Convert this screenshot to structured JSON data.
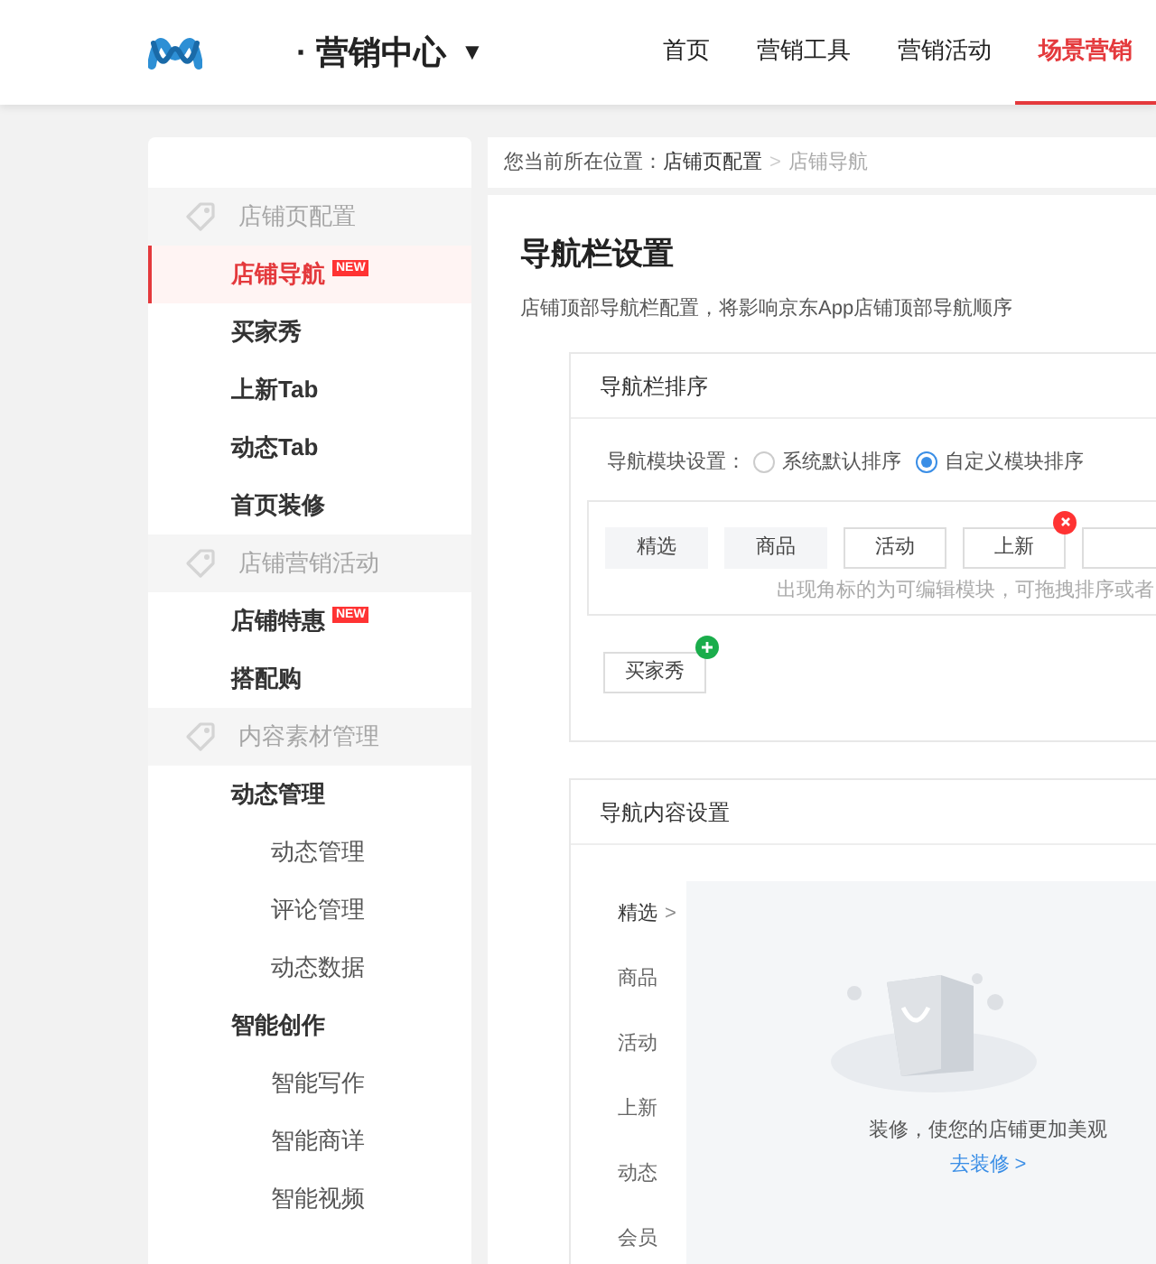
{
  "header": {
    "brand": "· 营销中心",
    "brand_caret": "▼",
    "nav": [
      {
        "label": "首页",
        "selected": false
      },
      {
        "label": "营销工具",
        "selected": false
      },
      {
        "label": "营销活动",
        "selected": false
      },
      {
        "label": "场景营销",
        "selected": true
      }
    ]
  },
  "sidebar": {
    "groups": [
      {
        "title": "店铺页配置",
        "items": [
          {
            "label": "店铺导航",
            "badge": "NEW",
            "selected": true
          },
          {
            "label": "买家秀",
            "selected": false
          },
          {
            "label": "上新Tab",
            "selected": false
          },
          {
            "label": "动态Tab",
            "selected": false
          },
          {
            "label": "首页装修",
            "selected": false
          }
        ]
      },
      {
        "title": "店铺营销活动",
        "items": [
          {
            "label": "店铺特惠",
            "badge": "NEW",
            "selected": false
          },
          {
            "label": "搭配购",
            "selected": false
          }
        ]
      },
      {
        "title": "内容素材管理",
        "items": [
          {
            "label": "动态管理",
            "selected": false,
            "children": [
              {
                "label": "动态管理",
                "selected": false
              },
              {
                "label": "评论管理",
                "selected": false
              },
              {
                "label": "动态数据",
                "selected": false
              }
            ]
          },
          {
            "label": "智能创作",
            "selected": false,
            "children": [
              {
                "label": "智能写作",
                "selected": false
              },
              {
                "label": "智能商详",
                "selected": false
              },
              {
                "label": "智能视频",
                "selected": false
              }
            ]
          }
        ]
      }
    ]
  },
  "breadcrumb": {
    "prefix": "您当前所在位置：",
    "items": [
      "店铺页配置",
      "店铺导航"
    ],
    "separator": ">"
  },
  "page": {
    "title": "导航栏设置",
    "description": "店铺顶部导航栏配置，将影响京东App店铺顶部导航顺序"
  },
  "sort_card": {
    "title": "导航栏排序",
    "radio_label": "导航模块设置：",
    "radios": [
      {
        "label": "系统默认排序",
        "selected": false
      },
      {
        "label": "自定义模块排序",
        "selected": true
      }
    ],
    "modules": [
      {
        "label": "精选",
        "kind": "fixed",
        "removable": false
      },
      {
        "label": "商品",
        "kind": "fixed",
        "removable": false
      },
      {
        "label": "活动",
        "kind": "editable",
        "removable": false
      },
      {
        "label": "上新",
        "kind": "editable",
        "removable": true
      },
      {
        "kind": "editable",
        "removable": false
      }
    ],
    "hint": "出现角标的为可编辑模块，可拖拽排序或者",
    "extra_modules": [
      {
        "label": "买家秀",
        "addable": true
      }
    ]
  },
  "content_card": {
    "title": "导航内容设置",
    "tabs": [
      {
        "label": "精选",
        "selected": true,
        "caret": ">"
      },
      {
        "label": "商品",
        "selected": false
      },
      {
        "label": "活动",
        "selected": false
      },
      {
        "label": "上新",
        "selected": false
      },
      {
        "label": "动态",
        "selected": false
      },
      {
        "label": "会员",
        "selected": false
      }
    ],
    "empty_text": "装修，使您的店铺更加美观",
    "empty_link": "去装修 >"
  }
}
